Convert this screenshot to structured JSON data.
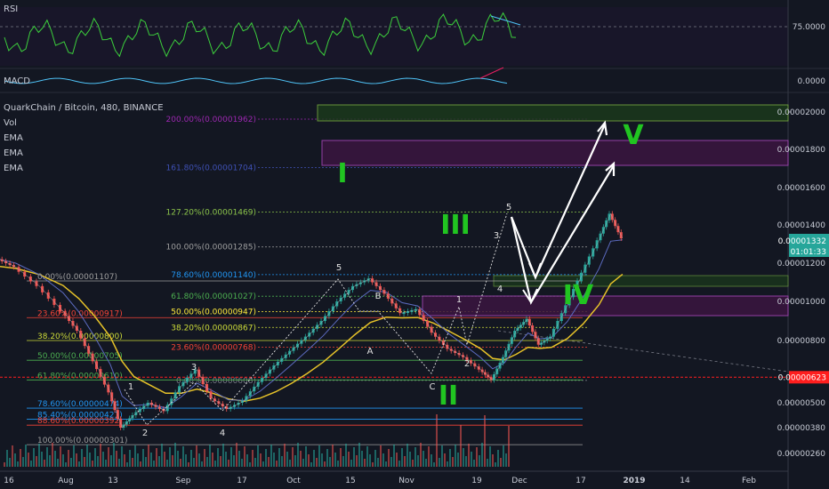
{
  "chart_data": {
    "type": "line",
    "title": "QuarkChain / Bitcoin, 480, BINANCE",
    "legend": [
      "Vol",
      "EMA",
      "EMA",
      "EMA"
    ],
    "indicators": {
      "rsi": {
        "name": "RSI",
        "level": "75.0000"
      },
      "macd": {
        "name": "MACD",
        "level": "0.0000"
      }
    },
    "x_ticks": [
      "16",
      "Aug",
      "13",
      "Sep",
      "17",
      "Oct",
      "15",
      "Nov",
      "19",
      "Dec",
      "17",
      "2019",
      "14",
      "Feb"
    ],
    "y_ticks": [
      "0.00002000",
      "0.00001800",
      "0.00001600",
      "0.00001400",
      "0.00001200",
      "0.00001000",
      "0.00000800",
      "0.00000500",
      "0.00000380",
      "0.00000260"
    ],
    "ylim": [
      2.5e-06,
      2.2e-06
    ],
    "price_label": {
      "value": "0.00001332",
      "countdown": "01:01:33",
      "color": "#26a69a"
    },
    "alert_label": {
      "value": "0.00000623",
      "color": "#ff1e1e"
    },
    "price_series": [
      [
        0,
        1.22e-05
      ],
      [
        0.02,
        1.18e-05
      ],
      [
        0.05,
        1.08e-05
      ],
      [
        0.08,
        9.5e-06
      ],
      [
        0.1,
        8.5e-06
      ],
      [
        0.12,
        7e-06
      ],
      [
        0.14,
        5.5e-06
      ],
      [
        0.155,
        3.8e-06
      ],
      [
        0.17,
        4.4e-06
      ],
      [
        0.19,
        5e-06
      ],
      [
        0.21,
        4.6e-06
      ],
      [
        0.23,
        5.8e-06
      ],
      [
        0.25,
        6.6e-06
      ],
      [
        0.27,
        5.2e-06
      ],
      [
        0.29,
        4.7e-06
      ],
      [
        0.31,
        5.1e-06
      ],
      [
        0.33,
        6e-06
      ],
      [
        0.35,
        6.8e-06
      ],
      [
        0.37,
        7.5e-06
      ],
      [
        0.39,
        8.2e-06
      ],
      [
        0.41,
        9e-06
      ],
      [
        0.43,
        1e-05
      ],
      [
        0.45,
        1.08e-05
      ],
      [
        0.47,
        1.12e-05
      ],
      [
        0.49,
        1.04e-05
      ],
      [
        0.51,
        9.4e-06
      ],
      [
        0.53,
        9.6e-06
      ],
      [
        0.55,
        8.4e-06
      ],
      [
        0.57,
        7.6e-06
      ],
      [
        0.59,
        7.2e-06
      ],
      [
        0.61,
        6.6e-06
      ],
      [
        0.625,
        6.1e-06
      ],
      [
        0.64,
        7.2e-06
      ],
      [
        0.655,
        8.5e-06
      ],
      [
        0.67,
        9.1e-06
      ],
      [
        0.685,
        7.8e-06
      ],
      [
        0.7,
        8.2e-06
      ],
      [
        0.72,
        9.8e-06
      ],
      [
        0.74,
        1.15e-05
      ],
      [
        0.76,
        1.32e-05
      ],
      [
        0.775,
        1.46e-05
      ],
      [
        0.79,
        1.33e-05
      ]
    ],
    "fib_upper": {
      "levels": [
        {
          "label": "200.00%(0.00001962)",
          "value": 1.962e-05,
          "color": "#9c27b0"
        },
        {
          "label": "161.80%(0.00001704)",
          "value": 1.704e-05,
          "color": "#3f51b5"
        },
        {
          "label": "127.20%(0.00001469)",
          "value": 1.469e-05,
          "color": "#8bc34a"
        },
        {
          "label": "100.00%(0.00001285)",
          "value": 1.285e-05,
          "color": "#9e9e9e"
        },
        {
          "label": "78.60%(0.00001140)",
          "value": 1.14e-05,
          "color": "#2196f3"
        },
        {
          "label": "61.80%(0.00001027)",
          "value": 1.027e-05,
          "color": "#4caf50"
        },
        {
          "label": "50.00%(0.00000947)",
          "value": 9.47e-06,
          "color": "#ffeb3b"
        },
        {
          "label": "38.20%(0.00000867)",
          "value": 8.67e-06,
          "color": "#cddc39"
        },
        {
          "label": "23.60%(0.00000768)",
          "value": 7.68e-06,
          "color": "#f44336"
        },
        {
          "label": "0.00%(0.00000608)",
          "value": 6.08e-06,
          "color": "#787b86"
        }
      ]
    },
    "fib_lower": {
      "levels": [
        {
          "label": "0.00%(0.00001107)",
          "value": 1.107e-05,
          "color": "#9e9e9e"
        },
        {
          "label": "23.60%(0.00000917)",
          "value": 9.17e-06,
          "color": "#f44336"
        },
        {
          "label": "38.20%(0.00000800)",
          "value": 8e-06,
          "color": "#cddc39"
        },
        {
          "label": "50.00%(0.00000705)",
          "value": 7.05e-06,
          "color": "#4caf50"
        },
        {
          "label": "61.80%(0.00000610)",
          "value": 6.1e-06,
          "color": "#4caf50"
        },
        {
          "label": "78.60%(0.00000474)",
          "value": 4.74e-06,
          "color": "#2196f3"
        },
        {
          "label": "85.40%(0.00000421)",
          "value": 4.21e-06,
          "color": "#2196f3"
        },
        {
          "label": "88.60%(0.00000392)",
          "value": 3.92e-06,
          "color": "#f44336"
        },
        {
          "label": "100.00%(0.00000301)",
          "value": 3.01e-06,
          "color": "#9e9e9e"
        }
      ]
    },
    "wave_labels": [
      {
        "text": "I",
        "color": "#21c521"
      },
      {
        "text": "II",
        "color": "#21c521"
      },
      {
        "text": "III",
        "color": "#21c521"
      },
      {
        "text": "IV",
        "color": "#21c521"
      },
      {
        "text": "V",
        "color": "#21c521"
      }
    ],
    "subwave_labels": [
      "1",
      "2",
      "3",
      "4",
      "5",
      "A",
      "B",
      "C",
      "1",
      "2",
      "3",
      "4",
      "5"
    ]
  }
}
